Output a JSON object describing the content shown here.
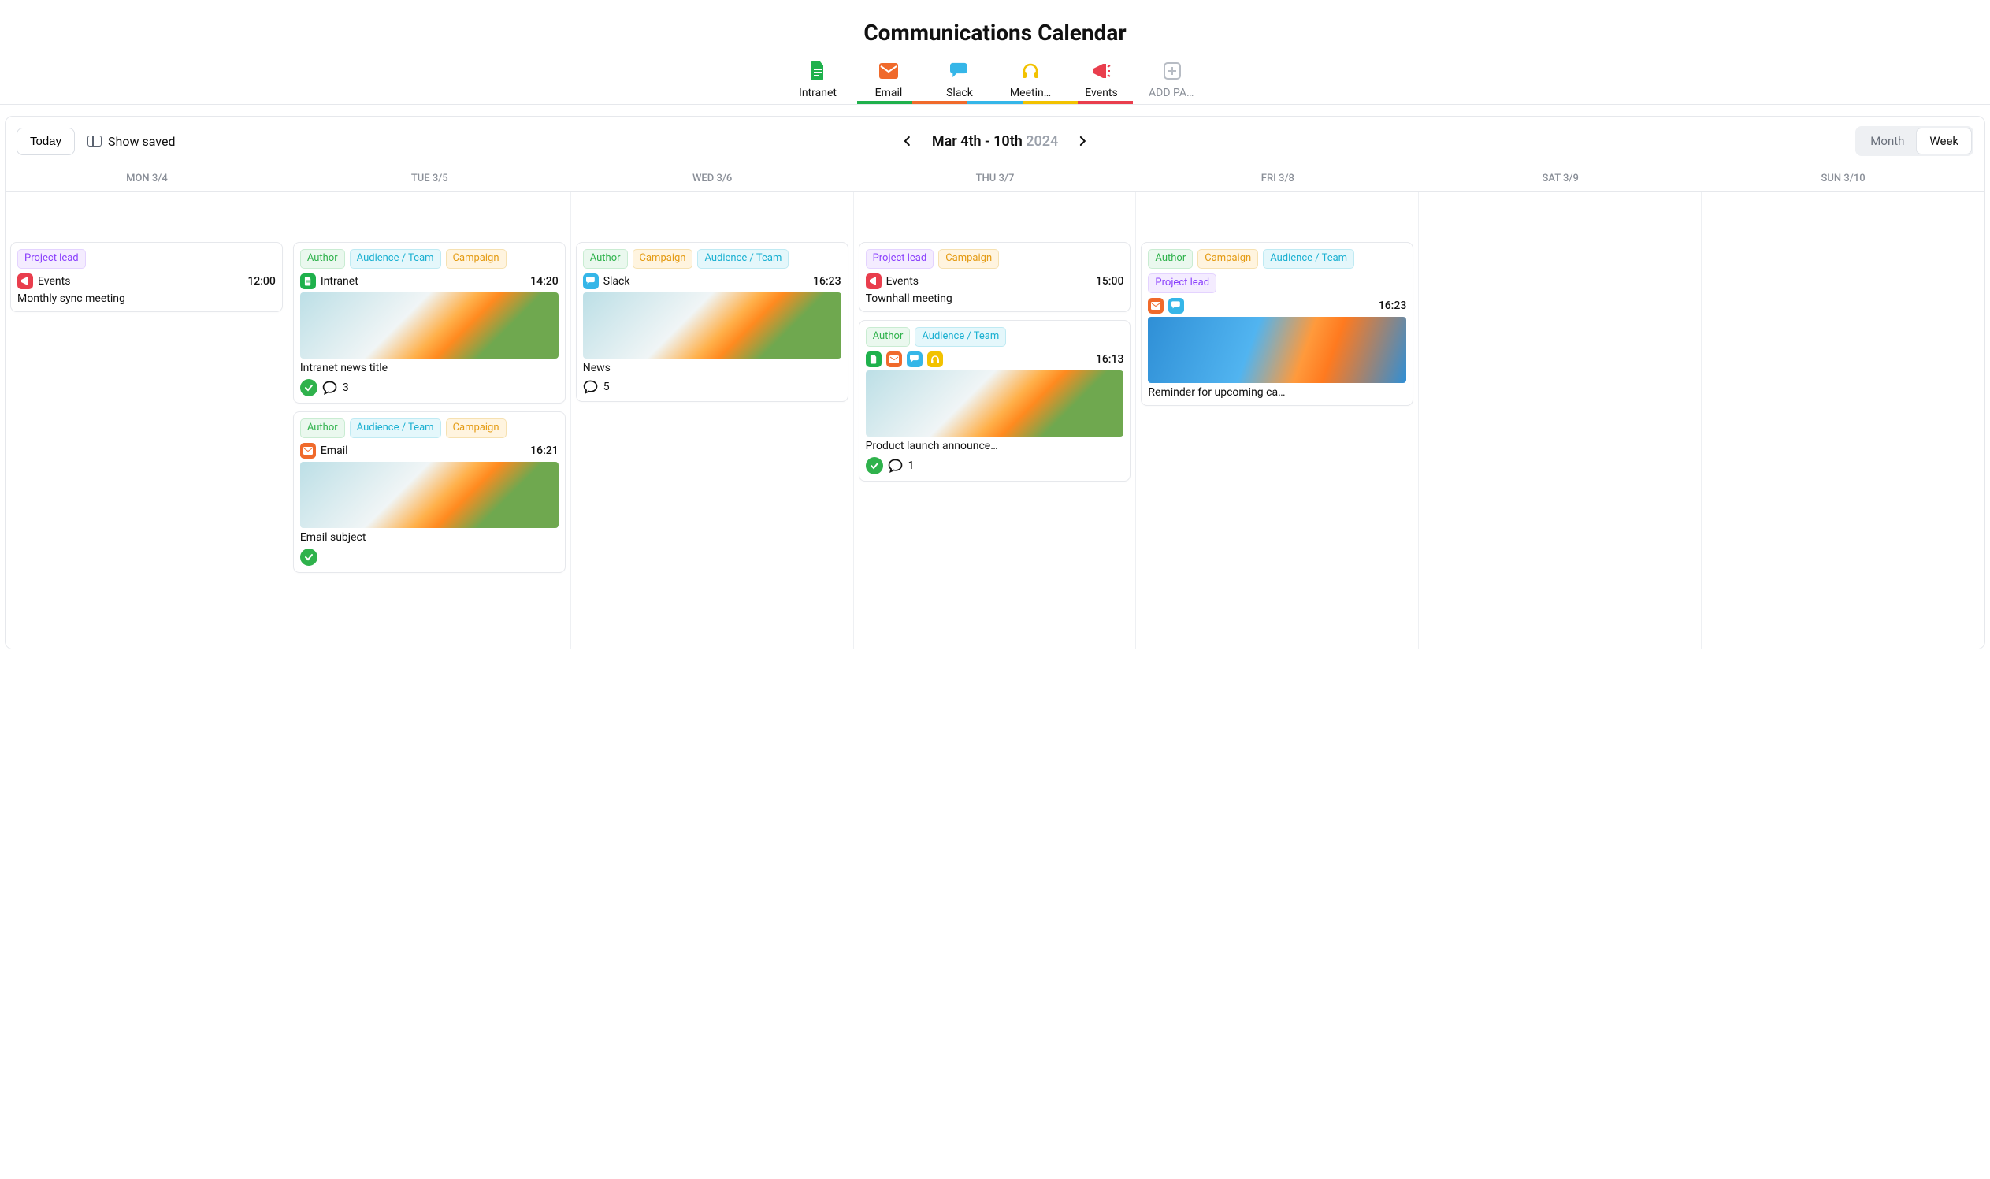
{
  "page": {
    "title": "Communications Calendar"
  },
  "tabs": {
    "items": [
      {
        "label": "Intranet",
        "color": "#1fb14c"
      },
      {
        "label": "Email",
        "color": "#f06a2b"
      },
      {
        "label": "Slack",
        "color": "#35b6e8"
      },
      {
        "label": "Meetin…",
        "color": "#f2c200"
      },
      {
        "label": "Events",
        "color": "#e93e4d"
      }
    ],
    "add_label": "ADD PAGES"
  },
  "toolbar": {
    "today_label": "Today",
    "show_saved_label": "Show saved",
    "date_range": "Mar 4th - 10th",
    "year": "2024",
    "view_month": "Month",
    "view_week": "Week",
    "active_view": "Week"
  },
  "day_headers": [
    "MON 3/4",
    "TUE 3/5",
    "WED 3/6",
    "THU 3/7",
    "FRI 3/8",
    "SAT 3/9",
    "SUN 3/10"
  ],
  "tag_labels": {
    "project_lead": "Project lead",
    "author": "Author",
    "audience": "Audience / Team",
    "campaign": "Campaign"
  },
  "channel_labels": {
    "events": "Events",
    "intranet": "Intranet",
    "email": "Email",
    "slack": "Slack"
  },
  "cards": {
    "mon": {
      "c1": {
        "time": "12:00",
        "title": "Monthly sync meeting"
      }
    },
    "tue": {
      "c1": {
        "time": "14:20",
        "title": "Intranet news title",
        "comments": "3"
      },
      "c2": {
        "time": "16:21",
        "title": "Email subject"
      }
    },
    "wed": {
      "c1": {
        "time": "16:23",
        "title": "News",
        "comments": "5"
      }
    },
    "thu": {
      "c1": {
        "time": "15:00",
        "title": "Townhall meeting"
      },
      "c2": {
        "time": "16:13",
        "title": "Product launch announce…",
        "comments": "1"
      }
    },
    "fri": {
      "c1": {
        "time": "16:23",
        "title": "Reminder for upcoming ca…"
      }
    }
  }
}
